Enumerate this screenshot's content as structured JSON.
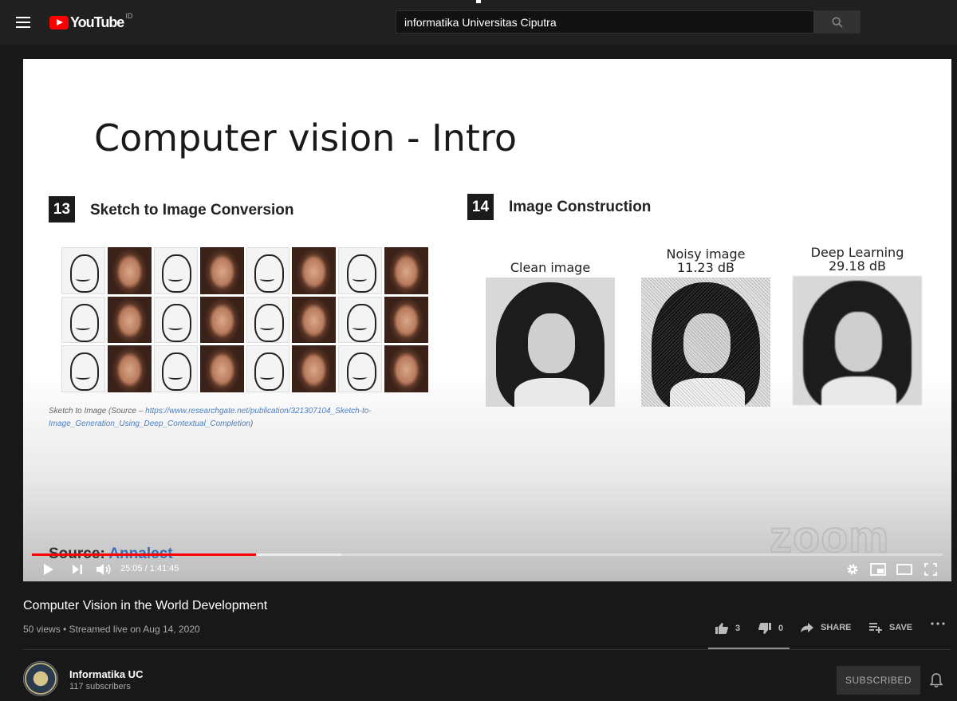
{
  "masthead": {
    "logo_text": "YouTube",
    "logo_country": "ID",
    "search_value": "informatika Universitas Ciputra"
  },
  "slide": {
    "title": "Computer vision - Intro",
    "section_13": {
      "number": "13",
      "title": "Sketch to Image Conversion"
    },
    "section_14": {
      "number": "14",
      "title": "Image Construction"
    },
    "caption_prefix": "Sketch to Image (Source – ",
    "caption_link": "https://www.researchgate.net/publication/321307104_Sketch-to-Image_Generation_Using_Deep_Contextual_Completion",
    "caption_suffix": ")",
    "clean_label": "Clean image",
    "noisy_label_1": "Noisy image",
    "noisy_label_2": "11.23 dB",
    "deep_label_1": "Deep Learning",
    "deep_label_2": "29.18 dB",
    "watermark": "zoom",
    "source_prefix": "Source: ",
    "source_link": "Annalect"
  },
  "player": {
    "time_current": "25:05",
    "time_total": "1:41:45",
    "time_display": "25:05 / 1:41:45",
    "played_fraction": 0.2464,
    "loaded_fraction": 0.34
  },
  "video": {
    "title": "Computer Vision in the World Development",
    "meta": "50 views • Streamed live on Aug 14, 2020",
    "likes": "3",
    "dislikes": "0",
    "share_label": "SHARE",
    "save_label": "SAVE"
  },
  "channel": {
    "name": "Informatika UC",
    "subscribers": "117 subscribers",
    "subscribed_label": "SUBSCRIBED"
  },
  "colors": {
    "brand_red": "#ff0000",
    "background": "#181818",
    "masthead": "#202020"
  }
}
